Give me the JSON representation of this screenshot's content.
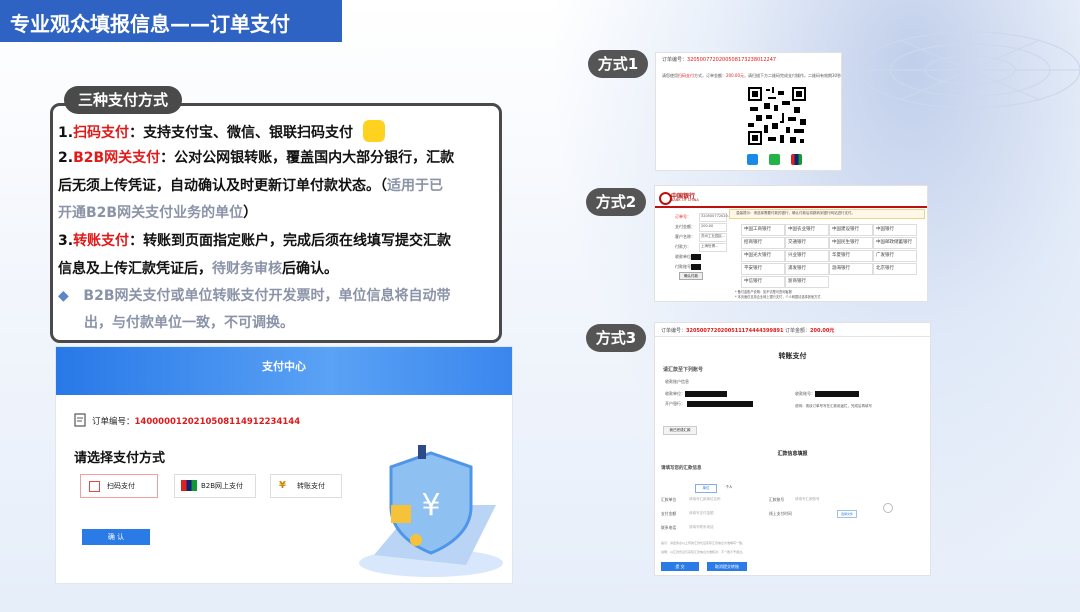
{
  "page": {
    "title": "专业观众填报信息——订单支付"
  },
  "summary": {
    "tag": "三种支付方式",
    "items": [
      {
        "prefix": "1.",
        "name": "扫码支付",
        "colon": "：",
        "text": "支持支付宝、微信、银联扫码支付"
      },
      {
        "prefix": "2.",
        "name": "B2B网关支付",
        "colon": "：",
        "text": "公对公网银转账，覆盖国内大部分银行，汇款",
        "text2": "后无须上传凭证，自动确认及时更新订单付款状态。",
        "note_open": "（",
        "note1": "适用于已",
        "note2": "开通B2B网关支付业务的单位",
        "note_close": "）"
      },
      {
        "prefix": "3.",
        "name": "转账支付",
        "colon": "：",
        "text": "转账到页面指定账户，完成后须在线填写提交汇款",
        "text2a": "信息及上传汇款凭证后，",
        "text2b": "待财务审核",
        "text2c": "后确认。"
      }
    ],
    "note_bullet": "◆",
    "note1": "B2B网关支付或单位转账支付开发票时，单位信息将自动带",
    "note2": "出，与付款单位一致，不可调换。"
  },
  "payment_center": {
    "header": "支付中心",
    "order_label": "订单编号：",
    "order_no": "140000012021050811491223414​4",
    "heading": "请选择支付方式",
    "options": [
      "扫码支付",
      "B2B网上支付",
      "转账支付"
    ],
    "confirm": "确 认"
  },
  "ways": [
    "方式1",
    "方式2",
    "方式3"
  ],
  "way1": {
    "order_label": "订单编号：",
    "order_no": "32050077202005081732380122​47",
    "hint_a": "请您使用",
    "hint_b": "扫码支付",
    "hint_c": "方式，订单金额：",
    "amount": "200.00元",
    "hint_d": "，请扫描下方二维码完成支付操作。二维码有效期30秒"
  },
  "way2": {
    "bank_name": "中国银行",
    "bank_en": "BANK OF CHINA",
    "notice": "温馨提示：请选择需要付款的银行，确认付款后将跳转到银行网站进行支付。",
    "form_labels": [
      "订单号：",
      "支付金额：",
      "客户名称：",
      "付款方：",
      "收款单位：",
      "付款账号："
    ],
    "form_values": [
      "320500772020...",
      "200.00",
      "苏州工业园区...",
      "上海世博...",
      "",
      ""
    ],
    "submit": "确认付款",
    "banks": [
      "中国工商银行",
      "中国农业银行",
      "中国建设银行",
      "中国银行",
      "招商银行",
      "交通银行",
      "中国民生银行",
      "中国邮政储蓄银行",
      "中国光大银行",
      "兴业银行",
      "华夏银行",
      "广发银行",
      "平安银行",
      "浦发银行",
      "渤海银行",
      "北京银行",
      "中信银行",
      "浙商银行"
    ],
    "foot1": "* 备付金账户说明：如不清楚可咨询客服",
    "foot2": "* 本页面仅支持企业网上银行支付，个人网银请选择其他方式"
  },
  "way3": {
    "order_label": "订单编号：",
    "order_no": "3205007720200511174444399891",
    "amount_label": "订单金额：",
    "amount": "200.00元",
    "title": "转账支付",
    "sub1": "请汇款至下列账号",
    "sub2": "收款账户信息",
    "payee_labels": [
      "收款单位：",
      "开户银行："
    ],
    "account_label": "收款账号：",
    "remark": "说明：请该订单号写在汇款用途栏，完成后再填写",
    "copy_btn": "我已完成汇款",
    "section2": "汇款信息填报",
    "section2_sub": "请填写您的汇款信息",
    "tabs": [
      "单位",
      "个人"
    ],
    "fields": [
      "汇款单位",
      "汇款账号",
      "支付金额",
      "线上支付时间",
      "联系电话"
    ],
    "placeholders": [
      "请填写汇款单位名称",
      "请填写汇款账号",
      "请填写支付金额",
      "请填写联系电话"
    ],
    "select_btn": "选择文件",
    "notice1": "提示：请您务必以上传的汇款凭证实际汇款信息为准填写一致。",
    "notice2": "说明：以汇款凭证与实际汇款信息为准核对，不一致不予通过。",
    "btn_submit": "提 交",
    "btn_reset": "取消提交转账"
  },
  "colors": {
    "title_bar": "#2f63c3",
    "accent_red": "#e11919",
    "note_gray": "#8a93a7",
    "pay_blue": "#2b7be6"
  }
}
